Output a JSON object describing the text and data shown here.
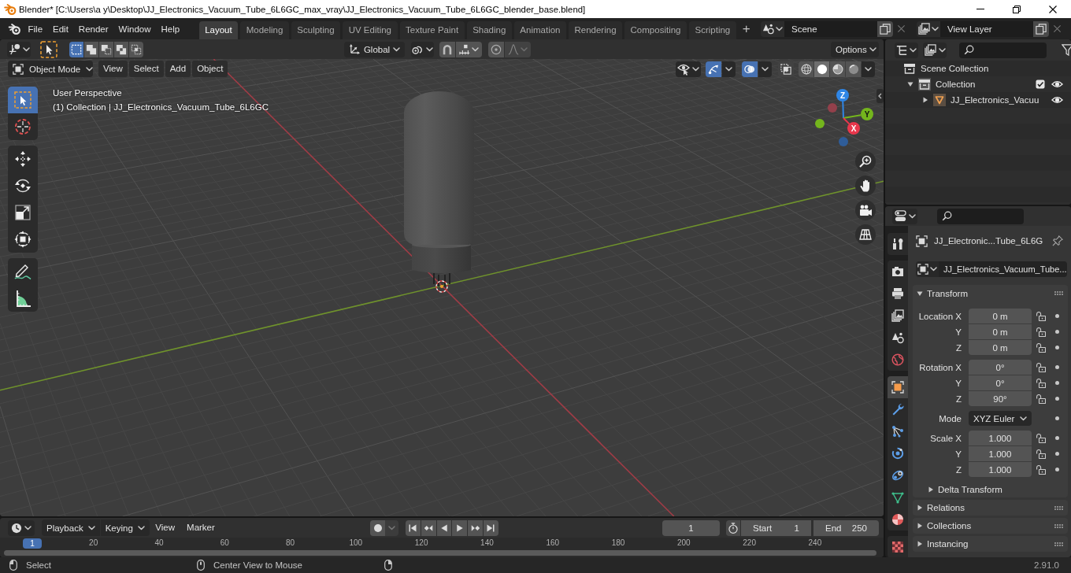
{
  "title_bar": {
    "title": "Blender* [C:\\Users\\a y\\Desktop\\JJ_Electronics_Vacuum_Tube_6L6GC_max_vray\\JJ_Electronics_Vacuum_Tube_6L6GC_blender_base.blend]"
  },
  "menu_bar": [
    {
      "label": "File"
    },
    {
      "label": "Edit"
    },
    {
      "label": "Render"
    },
    {
      "label": "Window"
    },
    {
      "label": "Help"
    }
  ],
  "workspace_tabs": [
    {
      "label": "Layout",
      "selected": true
    },
    {
      "label": "Modeling",
      "selected": false
    },
    {
      "label": "Sculpting",
      "selected": false
    },
    {
      "label": "UV Editing",
      "selected": false
    },
    {
      "label": "Texture Paint",
      "selected": false
    },
    {
      "label": "Shading",
      "selected": false
    },
    {
      "label": "Animation",
      "selected": false
    },
    {
      "label": "Rendering",
      "selected": false
    },
    {
      "label": "Compositing",
      "selected": false
    },
    {
      "label": "Scripting",
      "selected": false
    }
  ],
  "add_workspace": "+",
  "scene": {
    "value": "Scene"
  },
  "view_layer": {
    "value": "View Layer"
  },
  "tool_header": {
    "select_modes": [
      {
        "kind": "set",
        "selected": true
      },
      {
        "kind": "extend",
        "selected": false
      },
      {
        "kind": "subtract",
        "selected": false
      },
      {
        "kind": "invert",
        "selected": false
      },
      {
        "kind": "intersect",
        "selected": false
      }
    ],
    "orientation": "Global",
    "snap": {
      "on": false
    },
    "proportional_editing": {
      "on": false
    },
    "options": "Options"
  },
  "viewport_header": {
    "mode": "Object Mode",
    "menus": [
      "View",
      "Select",
      "Add",
      "Object"
    ],
    "gizmos": {
      "on": true
    },
    "overlays": {
      "on": true
    },
    "x_ray": {
      "on": false
    },
    "shading_modes": [
      {
        "kind": "wireframe",
        "selected": false
      },
      {
        "kind": "solid",
        "selected": true
      },
      {
        "kind": "material",
        "selected": false
      },
      {
        "kind": "rendered",
        "selected": false
      }
    ]
  },
  "toolbar": [
    {
      "tools": [
        {
          "kind": "select_box",
          "selected": true
        },
        {
          "kind": "cursor",
          "selected": false
        }
      ]
    },
    {
      "tools": [
        {
          "kind": "move",
          "selected": false
        },
        {
          "kind": "rotate",
          "selected": false
        },
        {
          "kind": "scale",
          "selected": false
        },
        {
          "kind": "transform",
          "selected": false
        }
      ]
    },
    {
      "tools": [
        {
          "kind": "annotate",
          "selected": false
        },
        {
          "kind": "measure",
          "selected": false
        }
      ]
    }
  ],
  "viewport_info": {
    "view": "User Perspective",
    "context": "(1) Collection | JJ_Electronics_Vacuum_Tube_6L6GC"
  },
  "navigation_gizmo": {
    "axes": [
      {
        "kind": "z",
        "label": "Z"
      },
      {
        "kind": "y",
        "label": "Y"
      },
      {
        "kind": "x",
        "label": "X"
      }
    ]
  },
  "outliner": {
    "tree": [
      {
        "kind": "scene_collection",
        "label": "Scene Collection",
        "children": [
          {
            "kind": "collection",
            "label": "Collection",
            "expanded": true,
            "checked": true,
            "visible": true,
            "children": [
              {
                "kind": "object",
                "label": "JJ_Electronics_Vacuu",
                "expanded": false,
                "visible": true
              }
            ]
          }
        ]
      }
    ]
  },
  "properties": {
    "tab_groups": [
      {
        "tabs": [
          {
            "kind": "tool",
            "selected": false
          }
        ]
      },
      {
        "tabs": [
          {
            "kind": "render",
            "selected": false
          },
          {
            "kind": "output",
            "selected": false
          },
          {
            "kind": "view_layer",
            "selected": false
          },
          {
            "kind": "scene",
            "selected": false
          },
          {
            "kind": "world",
            "selected": false
          }
        ]
      },
      {
        "tabs": [
          {
            "kind": "object",
            "selected": true
          },
          {
            "kind": "modifiers",
            "selected": false
          },
          {
            "kind": "particles",
            "selected": false
          },
          {
            "kind": "physics",
            "selected": false
          },
          {
            "kind": "constraints",
            "selected": false
          },
          {
            "kind": "data",
            "selected": false
          },
          {
            "kind": "material",
            "selected": false
          }
        ]
      },
      {
        "tabs": [
          {
            "kind": "texture",
            "selected": false
          }
        ]
      }
    ],
    "object_name": "JJ_Electronic...Tube_6L6G",
    "data_block": "JJ_Electronics_Vacuum_Tube...",
    "transform": {
      "title": "Transform",
      "expanded": true,
      "groups": [
        {
          "rows": [
            {
              "kind": "number",
              "label": "Location X",
              "value": "0 m",
              "locked": false
            },
            {
              "kind": "number",
              "label": "Y",
              "value": "0 m",
              "locked": false
            },
            {
              "kind": "number",
              "label": "Z",
              "value": "0 m",
              "locked": false
            }
          ]
        },
        {
          "rows": [
            {
              "kind": "number",
              "label": "Rotation X",
              "value": "0°",
              "locked": false
            },
            {
              "kind": "number",
              "label": "Y",
              "value": "0°",
              "locked": false
            },
            {
              "kind": "number",
              "label": "Z",
              "value": "90°",
              "locked": false
            }
          ]
        },
        {
          "rows": [
            {
              "kind": "dropdown",
              "label": "Mode",
              "value": "XYZ Euler"
            }
          ]
        },
        {
          "rows": [
            {
              "kind": "number",
              "label": "Scale X",
              "value": "1.000",
              "locked": false
            },
            {
              "kind": "number",
              "label": "Y",
              "value": "1.000",
              "locked": false
            },
            {
              "kind": "number",
              "label": "Z",
              "value": "1.000",
              "locked": false
            }
          ]
        }
      ],
      "subpanels": [
        {
          "title": "Delta Transform",
          "expanded": false
        }
      ]
    },
    "panels": [
      {
        "title": "Relations",
        "expanded": false
      },
      {
        "title": "Collections",
        "expanded": false
      },
      {
        "title": "Instancing",
        "expanded": false
      }
    ]
  },
  "timeline": {
    "menus": [
      {
        "kind": "dropdown",
        "label": "Playback"
      },
      {
        "kind": "dropdown",
        "label": "Keying"
      },
      {
        "kind": "menu",
        "label": "View"
      },
      {
        "kind": "menu",
        "label": "Marker"
      }
    ],
    "auto_keying": {
      "on": false
    },
    "current_frame": "1",
    "preview_range": {
      "on": false
    },
    "start": {
      "label": "Start",
      "value": "1"
    },
    "end": {
      "label": "End",
      "value": "250"
    },
    "frame_indicator": "1",
    "ruler": [
      "20",
      "40",
      "60",
      "80",
      "100",
      "120",
      "140",
      "160",
      "180",
      "200",
      "220",
      "240"
    ]
  },
  "status_bar": {
    "hints": [
      {
        "kind": "left_mouse",
        "text": "Select"
      },
      {
        "kind": "middle_mouse",
        "text": "Center View to Mouse"
      },
      {
        "kind": "right_mouse"
      }
    ],
    "version": "2.91.0"
  }
}
